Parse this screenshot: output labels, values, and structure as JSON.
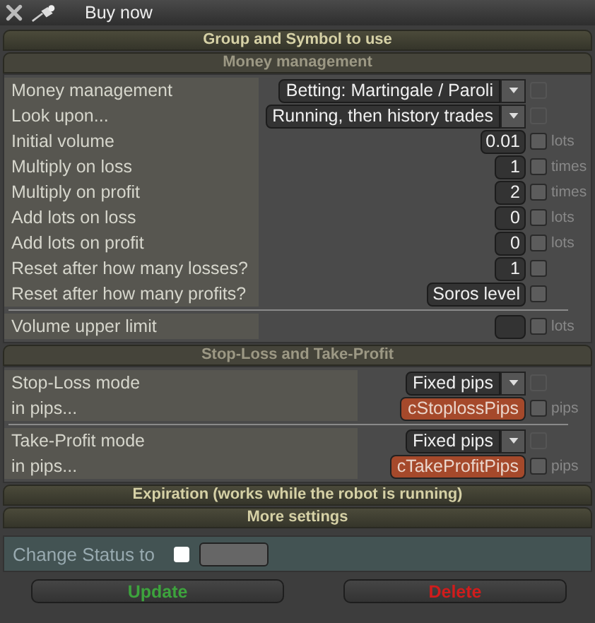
{
  "window": {
    "title": "Buy now"
  },
  "sections": [
    {
      "title": "Group and Symbol to use",
      "expanded": false
    },
    {
      "title": "Money management",
      "expanded": true,
      "groups": [
        [
          {
            "label": "Money management",
            "kind": "dropdown",
            "value": "Betting: Martingale / Paroli",
            "check_disabled": true
          },
          {
            "label": "Look upon...",
            "kind": "dropdown",
            "value": "Running, then history trades",
            "check_disabled": true
          },
          {
            "label": "Initial volume",
            "kind": "input",
            "value": "0.01",
            "unit": "lots",
            "check_disabled": false
          },
          {
            "label": "Multiply on loss",
            "kind": "input",
            "value": "1",
            "unit": "times",
            "check_disabled": false
          },
          {
            "label": "Multiply on profit",
            "kind": "input",
            "value": "2",
            "unit": "times",
            "check_disabled": false
          },
          {
            "label": "Add lots on loss",
            "kind": "input",
            "value": "0",
            "unit": "lots",
            "check_disabled": false
          },
          {
            "label": "Add lots on profit",
            "kind": "input",
            "value": "0",
            "unit": "lots",
            "check_disabled": false
          },
          {
            "label": "Reset after how many losses?",
            "kind": "input",
            "value": "1",
            "check_disabled": false
          },
          {
            "label": "Reset after how many profits?",
            "kind": "input",
            "value": "Soros level",
            "check_disabled": false
          }
        ],
        [
          {
            "label": "Volume upper limit",
            "kind": "input",
            "unit": "lots",
            "check_disabled": false
          }
        ]
      ]
    },
    {
      "title": "Stop-Loss and Take-Profit",
      "expanded": true,
      "groups": [
        [
          {
            "label": "Stop-Loss mode",
            "kind": "dropdown",
            "value": "Fixed pips",
            "check_disabled": true
          },
          {
            "label": "in pips...",
            "kind": "variable",
            "value": "cStoplossPips",
            "unit": "pips",
            "check_disabled": false
          }
        ],
        [
          {
            "label": "Take-Profit mode",
            "kind": "dropdown",
            "value": "Fixed pips",
            "check_disabled": true
          },
          {
            "label": "in pips...",
            "kind": "variable",
            "value": "cTakeProfitPips",
            "unit": "pips",
            "check_disabled": false
          }
        ]
      ]
    },
    {
      "title": "Expiration (works while the robot is running)",
      "expanded": false
    },
    {
      "title": "More settings",
      "expanded": false
    }
  ],
  "status": {
    "label": "Change Status to",
    "checked": false
  },
  "buttons": [
    {
      "label": "Update",
      "kind": "confirm"
    },
    {
      "label": "Delete",
      "kind": "danger"
    }
  ]
}
